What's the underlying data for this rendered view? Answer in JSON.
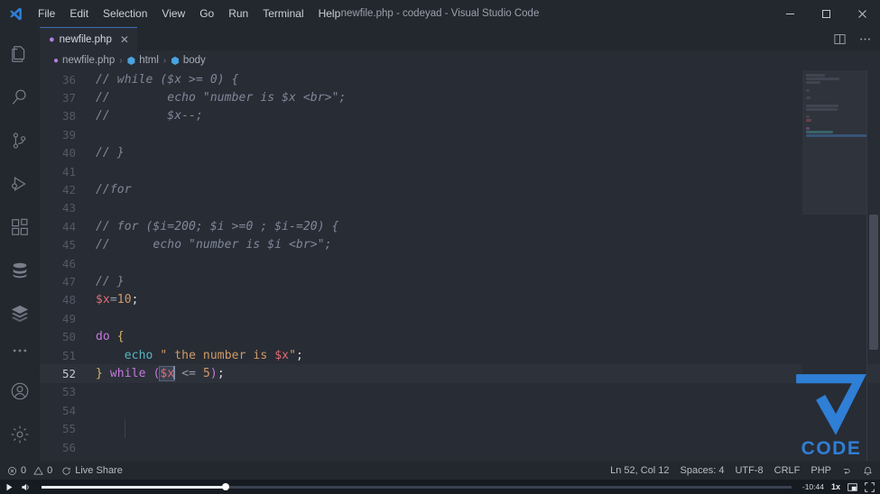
{
  "window": {
    "title": "newfile.php - codeyad - Visual Studio Code",
    "minimize": "–",
    "maximize": "❐",
    "close": "✕"
  },
  "menubar": {
    "items": [
      "File",
      "Edit",
      "Selection",
      "View",
      "Go",
      "Run",
      "Terminal",
      "Help"
    ]
  },
  "activitybar": {
    "top": [
      {
        "name": "explorer-icon",
        "label": "Explorer"
      },
      {
        "name": "search-icon",
        "label": "Search"
      },
      {
        "name": "source-control-icon",
        "label": "Source Control"
      },
      {
        "name": "run-debug-icon",
        "label": "Run and Debug"
      },
      {
        "name": "extensions-icon",
        "label": "Extensions"
      },
      {
        "name": "database-icon",
        "label": "Database"
      },
      {
        "name": "layers-icon",
        "label": "Layers"
      },
      {
        "name": "more-actions-icon",
        "label": "Additional Views"
      }
    ],
    "bottom": [
      {
        "name": "account-icon",
        "label": "Accounts"
      },
      {
        "name": "settings-gear-icon",
        "label": "Manage"
      }
    ]
  },
  "tabs": [
    {
      "label": "newfile.php",
      "icon": "php-file-icon",
      "close": "✕",
      "active": true
    }
  ],
  "editor_actions": [
    {
      "name": "split-editor-icon",
      "glyph": "◫"
    },
    {
      "name": "more-actions-icon",
      "glyph": "⋯"
    }
  ],
  "breadcrumb": {
    "items": [
      {
        "label": "newfile.php",
        "icon": "php-file-icon"
      },
      {
        "label": "html",
        "icon": "symbol-cube-icon"
      },
      {
        "label": "body",
        "icon": "symbol-cube-icon"
      }
    ],
    "separator": "›"
  },
  "code": {
    "first_line": 36,
    "current_line": 52,
    "lines": [
      {
        "n": 36,
        "tokens": [
          {
            "t": "// while ($x >= 0) {",
            "c": "cmt"
          }
        ]
      },
      {
        "n": 37,
        "tokens": [
          {
            "t": "//        echo \"number is $x <br>\";",
            "c": "cmt"
          }
        ]
      },
      {
        "n": 38,
        "tokens": [
          {
            "t": "//        $x--;",
            "c": "cmt"
          }
        ]
      },
      {
        "n": 39,
        "tokens": []
      },
      {
        "n": 40,
        "tokens": [
          {
            "t": "// }",
            "c": "cmt"
          }
        ]
      },
      {
        "n": 41,
        "tokens": []
      },
      {
        "n": 42,
        "tokens": [
          {
            "t": "//for",
            "c": "cmt"
          }
        ]
      },
      {
        "n": 43,
        "tokens": []
      },
      {
        "n": 44,
        "tokens": [
          {
            "t": "// for ($i=200; $i >=0 ; $i-=20) {",
            "c": "cmt"
          }
        ]
      },
      {
        "n": 45,
        "tokens": [
          {
            "t": "//      echo \"number is $i <br>\";",
            "c": "cmt"
          }
        ]
      },
      {
        "n": 46,
        "tokens": []
      },
      {
        "n": 47,
        "tokens": [
          {
            "t": "// }",
            "c": "cmt"
          }
        ]
      },
      {
        "n": 48,
        "tokens": [
          {
            "t": "$x",
            "c": "var"
          },
          {
            "t": "=",
            "c": "op"
          },
          {
            "t": "10",
            "c": "num"
          },
          {
            "t": ";",
            "c": "br"
          }
        ]
      },
      {
        "n": 49,
        "tokens": []
      },
      {
        "n": 50,
        "tokens": [
          {
            "t": "do",
            "c": "kw"
          },
          {
            "t": " ",
            "c": "br"
          },
          {
            "t": "{",
            "c": "bry"
          }
        ]
      },
      {
        "n": 51,
        "tokens": [
          {
            "t": "    ",
            "c": "br"
          },
          {
            "t": "echo",
            "c": "fn"
          },
          {
            "t": " ",
            "c": "br"
          },
          {
            "t": "\" the number is ",
            "c": "str"
          },
          {
            "t": "$x",
            "c": "var"
          },
          {
            "t": "\"",
            "c": "str"
          },
          {
            "t": ";",
            "c": "br"
          }
        ]
      },
      {
        "n": 52,
        "tokens": [
          {
            "t": "}",
            "c": "bry"
          },
          {
            "t": " ",
            "c": "br"
          },
          {
            "t": "while",
            "c": "kw"
          },
          {
            "t": " ",
            "c": "br"
          },
          {
            "t": "(",
            "c": "brv"
          },
          {
            "t": "$x",
            "c": "var",
            "sel": true
          },
          {
            "t": " ",
            "c": "br"
          },
          {
            "t": "<=",
            "c": "op"
          },
          {
            "t": " ",
            "c": "br"
          },
          {
            "t": "5",
            "c": "num"
          },
          {
            "t": ")",
            "c": "brv"
          },
          {
            "t": ";",
            "c": "br"
          }
        ]
      },
      {
        "n": 53,
        "tokens": []
      },
      {
        "n": 54,
        "tokens": []
      },
      {
        "n": 55,
        "tokens": []
      },
      {
        "n": 56,
        "tokens": []
      }
    ]
  },
  "statusbar": {
    "left": [
      {
        "name": "problems-errors",
        "glyph": "ⓧ",
        "label": "0"
      },
      {
        "name": "problems-warnings",
        "glyph": "⚠",
        "label": "0"
      },
      {
        "name": "live-share",
        "glyph": "⟳",
        "label": "Live Share"
      }
    ],
    "right": [
      {
        "name": "editor-position",
        "label": "Ln 52, Col 12"
      },
      {
        "name": "indentation",
        "label": "Spaces: 4"
      },
      {
        "name": "encoding",
        "label": "UTF-8"
      },
      {
        "name": "eol",
        "label": "CRLF"
      },
      {
        "name": "language-mode",
        "label": "PHP"
      },
      {
        "name": "remote-indicator",
        "glyph": "⎇"
      },
      {
        "name": "notifications-bell",
        "glyph": "ὑ4"
      }
    ]
  },
  "videobar": {
    "play": "▶",
    "volume": "🔊",
    "progress_percent": 24.5,
    "time_remaining": "-10:44",
    "speed": "1x",
    "pip": "◱",
    "fullscreen": "⛶"
  },
  "watermark": {
    "text": "CODE"
  },
  "colors": {
    "titlebar_bg": "#23272e",
    "editor_bg": "#282c34",
    "accent_blue": "#2f7fd6",
    "keyword": "#c678dd",
    "variable": "#e06c75",
    "string": "#d19a66",
    "function": "#56b6c2",
    "comment": "#7f8899"
  }
}
